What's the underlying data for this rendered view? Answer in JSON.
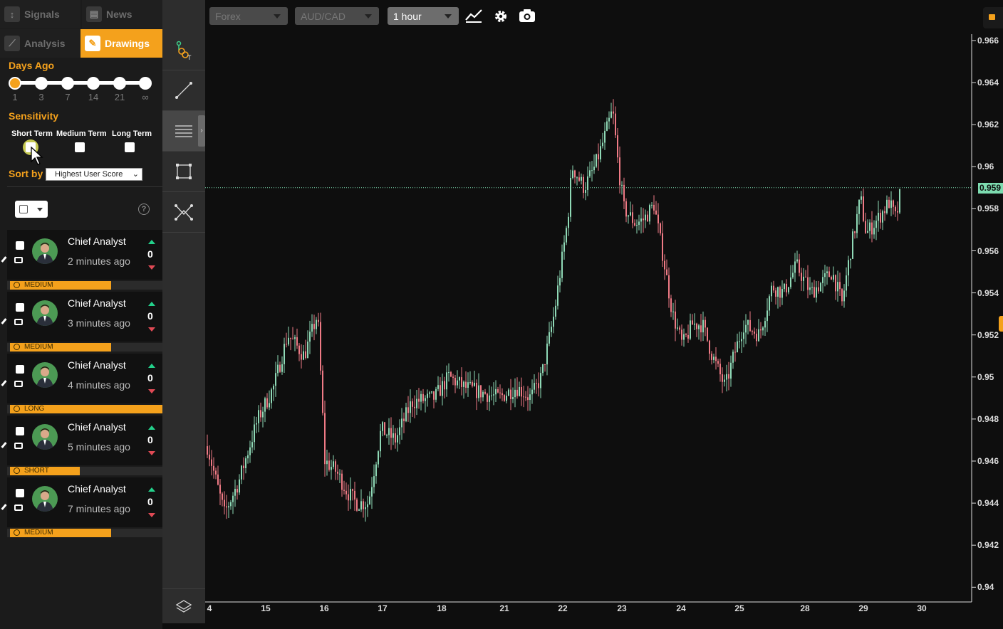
{
  "tabs": {
    "signals": "Signals",
    "news": "News",
    "analysis": "Analysis",
    "drawings": "Drawings"
  },
  "days_ago": {
    "label": "Days Ago",
    "ticks": [
      "1",
      "3",
      "7",
      "14",
      "21",
      "∞"
    ],
    "selected": "1"
  },
  "sensitivity": {
    "label": "Sensitivity",
    "options": [
      "Short Term",
      "Medium Term",
      "Long Term"
    ]
  },
  "sort": {
    "label": "Sort by",
    "value": "Highest User Score"
  },
  "cards": [
    {
      "name": "Chief Analyst",
      "time": "2 minutes ago",
      "score": "0",
      "tag": "MEDIUM"
    },
    {
      "name": "Chief Analyst",
      "time": "3 minutes ago",
      "score": "0",
      "tag": "MEDIUM"
    },
    {
      "name": "Chief Analyst",
      "time": "4 minutes ago",
      "score": "0",
      "tag": "LONG"
    },
    {
      "name": "Chief Analyst",
      "time": "5 minutes ago",
      "score": "0",
      "tag": "SHORT"
    },
    {
      "name": "Chief Analyst",
      "time": "7 minutes ago",
      "score": "0",
      "tag": "MEDIUM"
    }
  ],
  "toolbar": {
    "market": "Forex",
    "pair": "AUD/CAD",
    "interval": "1 hour"
  },
  "chart_data": {
    "type": "candlestick",
    "y_ticks": [
      "0.966",
      "0.964",
      "0.962",
      "0.96",
      "0.958",
      "0.956",
      "0.954",
      "0.952",
      "0.95",
      "0.948",
      "0.946",
      "0.944",
      "0.942",
      "0.94"
    ],
    "x_ticks": [
      "4",
      "15",
      "16",
      "17",
      "18",
      "21",
      "22",
      "23",
      "24",
      "25",
      "28",
      "29",
      "30"
    ],
    "current_price": "0.959",
    "ylim": [
      0.94,
      0.966
    ],
    "colors": {
      "up": "#8fd9b6",
      "down": "#ef7a85"
    }
  }
}
